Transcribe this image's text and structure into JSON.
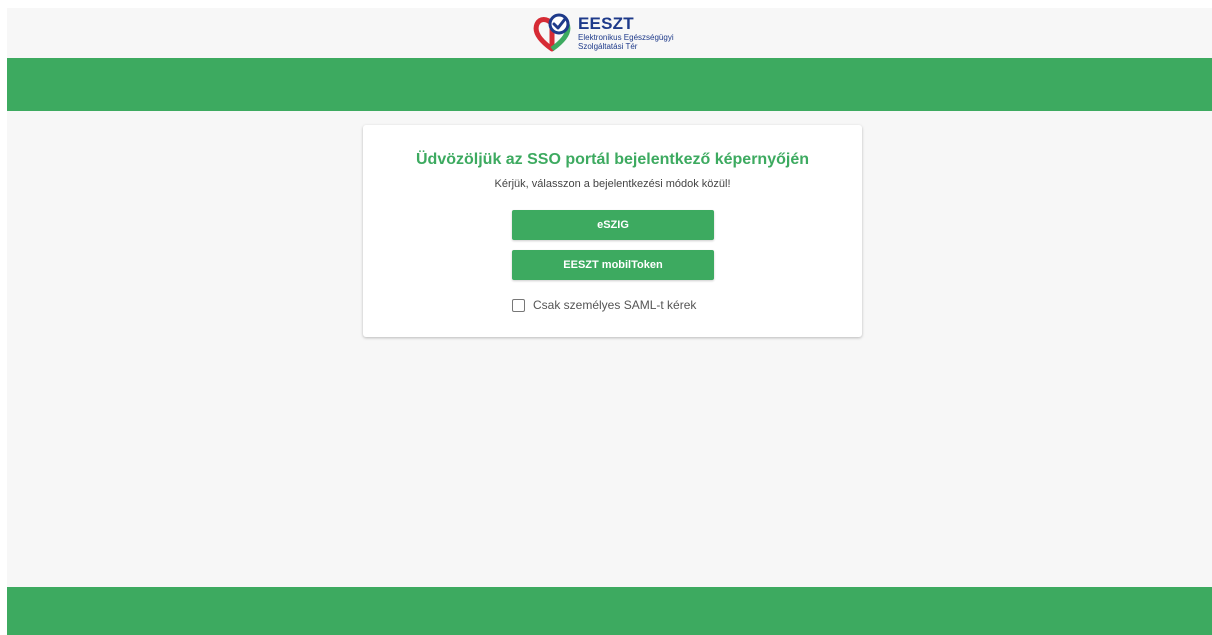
{
  "header": {
    "logo": {
      "title": "EESZT",
      "subtitle_line1": "Elektronikus Egészségügyi",
      "subtitle_line2": "Szolgáltatási Tér",
      "colors": {
        "blue": "#1e3a8a",
        "red": "#d62b35",
        "green": "#3daa60"
      }
    }
  },
  "theme": {
    "accent": "#3daa60",
    "background": "#f7f7f7"
  },
  "login_card": {
    "title": "Üdvözöljük az SSO portál bejelentkező képernyőjén",
    "subtitle": "Kérjük, válasszon a bejelentkezési módok közül!",
    "buttons": {
      "eszig_label": "eSZIG",
      "mobiltoken_label": "EESZT mobilToken"
    },
    "checkbox": {
      "label": "Csak személyes SAML-t kérek",
      "checked": false
    }
  }
}
